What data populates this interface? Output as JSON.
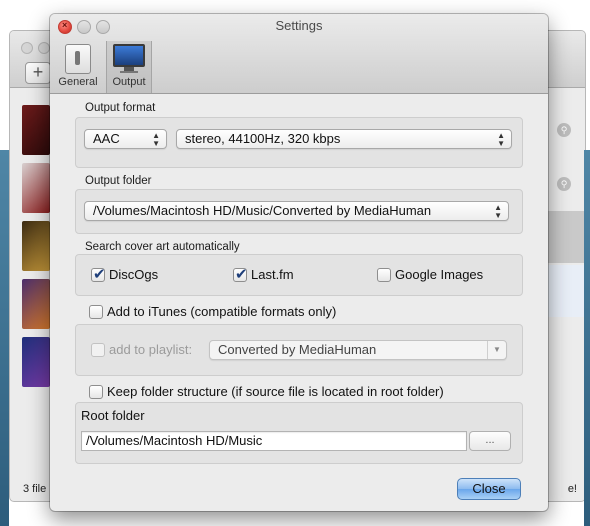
{
  "dialog": {
    "title": "Settings",
    "toolbar": {
      "general_label": "General",
      "output_label": "Output"
    }
  },
  "output_format": {
    "label": "Output format",
    "format_value": "AAC",
    "quality_value": "stereo, 44100Hz, 320 kbps"
  },
  "output_folder": {
    "label": "Output folder",
    "path_value": "/Volumes/Macintosh HD/Music/Converted by MediaHuman"
  },
  "cover_art": {
    "label": "Search cover art automatically",
    "discogs": {
      "label": "DiscOgs",
      "checked": true
    },
    "lastfm": {
      "label": "Last.fm",
      "checked": true
    },
    "google": {
      "label": "Google Images",
      "checked": false
    }
  },
  "itunes": {
    "add_label": "Add to iTunes (compatible formats only)",
    "add_checked": false,
    "playlist_label": "add to playlist:",
    "playlist_value": "Converted by MediaHuman"
  },
  "folder_structure": {
    "keep_label": "Keep folder structure (if source file is located in root folder)",
    "keep_checked": false,
    "root_label": "Root folder",
    "root_value": "/Volumes/Macintosh HD/Music",
    "browse_label": "..."
  },
  "buttons": {
    "close_label": "Close"
  },
  "background": {
    "status_left": "3 file",
    "status_right": "e!"
  },
  "colors": {
    "accent": "#6aa6eb",
    "close_light": "#e2463c",
    "check_mark": "#1f3f7a"
  }
}
